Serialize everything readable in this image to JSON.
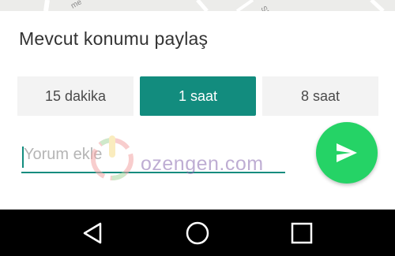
{
  "map": {
    "street_label_1": "me",
    "street_label_2": "Sk"
  },
  "sheet": {
    "title": "Mevcut konumu paylaş"
  },
  "duration_options": [
    {
      "label": "15 dakika",
      "selected": false
    },
    {
      "label": "1 saat",
      "selected": true
    },
    {
      "label": "8 saat",
      "selected": false
    }
  ],
  "comment": {
    "placeholder": "Yorum ekle",
    "value": ""
  },
  "send": {
    "icon": "send-icon"
  },
  "watermark": {
    "text": "ozengen.com"
  },
  "navigation_bar": {
    "back_icon": "back-triangle-icon",
    "home_icon": "home-circle-icon",
    "recents_icon": "recents-square-icon"
  },
  "colors": {
    "accent": "#128c7e",
    "send_button": "#25d366",
    "segment_bg": "#f3f3f3",
    "navbar": "#000000"
  }
}
